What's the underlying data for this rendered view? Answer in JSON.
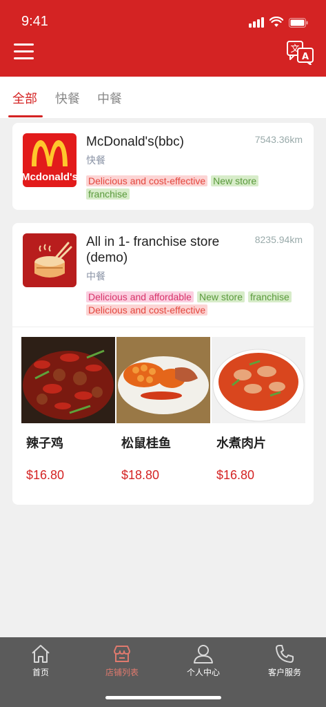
{
  "status_bar": {
    "time": "9:41"
  },
  "header": {
    "menu_icon": "hamburger-menu-icon",
    "translate_icon": "translate-icon"
  },
  "tabs": [
    {
      "label": "全部",
      "active": true
    },
    {
      "label": "快餐",
      "active": false
    },
    {
      "label": "中餐",
      "active": false
    }
  ],
  "shops": [
    {
      "name": "McDonald's(bbc)",
      "distance": "7543.36km",
      "category": "快餐",
      "logo_text": "Mcdonald's",
      "tags": [
        {
          "text": "Delicious and cost-effective",
          "color": "red"
        },
        {
          "text": "New store",
          "color": "green"
        },
        {
          "text": "franchise",
          "color": "green"
        }
      ]
    },
    {
      "name_line1": "All in 1- franchise store",
      "name_line2": "(demo)",
      "distance": "8235.94km",
      "category": "中餐",
      "tags": [
        {
          "text": "Delicious and affordable",
          "color": "pink"
        },
        {
          "text": "New store",
          "color": "green"
        },
        {
          "text": "franchise",
          "color": "green"
        },
        {
          "text": "Delicious and cost-effective",
          "color": "red"
        }
      ],
      "dishes": [
        {
          "name": "辣子鸡",
          "price": "$16.80"
        },
        {
          "name": "松鼠桂鱼",
          "price": "$18.80"
        },
        {
          "name": "水煮肉片",
          "price": "$16.80"
        }
      ]
    }
  ],
  "bottom_nav": [
    {
      "label": "首页",
      "icon": "home-icon",
      "active": false
    },
    {
      "label": "店铺列表",
      "icon": "store-icon",
      "active": true
    },
    {
      "label": "个人中心",
      "icon": "user-icon",
      "active": false
    },
    {
      "label": "客户服务",
      "icon": "phone-icon",
      "active": false
    }
  ],
  "colors": {
    "brand": "#d42323",
    "nav_bg": "#5b5b5b",
    "active_nav": "#e07a6e"
  }
}
